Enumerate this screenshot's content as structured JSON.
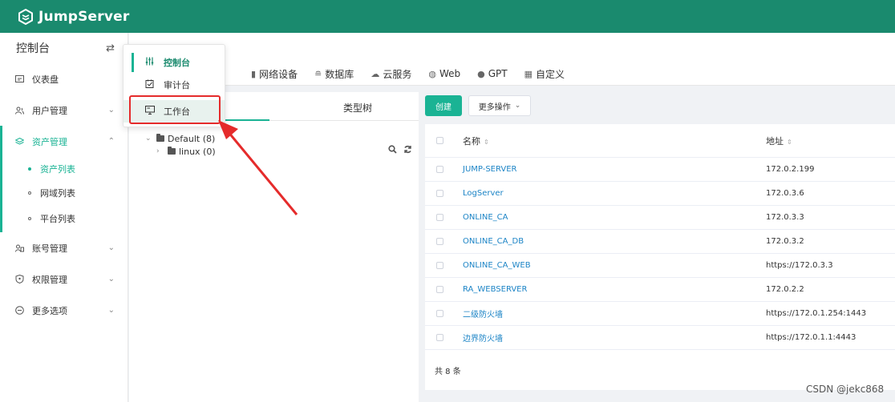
{
  "app": {
    "name": "JumpServer",
    "brand_color": "#1a8a6e",
    "accent_color": "#1ab394",
    "link_color": "#1c84c6"
  },
  "sidebar": {
    "title": "控制台",
    "items": [
      {
        "label": "仪表盘",
        "icon": "dashboard-icon"
      },
      {
        "label": "用户管理",
        "icon": "users-icon"
      },
      {
        "label": "资产管理",
        "icon": "assets-icon"
      },
      {
        "label": "账号管理",
        "icon": "accounts-icon"
      },
      {
        "label": "权限管理",
        "icon": "permission-icon"
      },
      {
        "label": "更多选项",
        "icon": "more-icon"
      }
    ],
    "asset_sub": [
      "资产列表",
      "网域列表",
      "平台列表"
    ]
  },
  "view_menu": {
    "items": [
      {
        "label": "控制台",
        "icon": "sliders-icon"
      },
      {
        "label": "审计台",
        "icon": "audit-icon"
      },
      {
        "label": "工作台",
        "icon": "monitor-icon"
      }
    ]
  },
  "tabs": [
    {
      "label": "网络设备",
      "icon": "network-device-icon"
    },
    {
      "label": "数据库",
      "icon": "database-icon"
    },
    {
      "label": "云服务",
      "icon": "cloud-icon"
    },
    {
      "label": "Web",
      "icon": "globe-icon"
    },
    {
      "label": "GPT",
      "icon": "chat-icon"
    },
    {
      "label": "自定义",
      "icon": "grid-icon"
    }
  ],
  "tree": {
    "tab_type": "类型树",
    "nodes": [
      {
        "label": "Default (8)"
      },
      {
        "label": "linux (0)"
      }
    ]
  },
  "toolbar": {
    "create": "创建",
    "more_actions": "更多操作"
  },
  "table": {
    "headers": {
      "name": "名称",
      "address": "地址"
    },
    "rows": [
      {
        "name": "JUMP-SERVER",
        "address": "172.0.2.199"
      },
      {
        "name": "LogServer",
        "address": "172.0.3.6"
      },
      {
        "name": "ONLINE_CA",
        "address": "172.0.3.3"
      },
      {
        "name": "ONLINE_CA_DB",
        "address": "172.0.3.2"
      },
      {
        "name": "ONLINE_CA_WEB",
        "address": "https://172.0.3.3"
      },
      {
        "name": "RA_WEBSERVER",
        "address": "172.0.2.2"
      },
      {
        "name": "二级防火墙",
        "address": "https://172.0.1.254:1443"
      },
      {
        "name": "边界防火墙",
        "address": "https://172.0.1.1:4443"
      }
    ],
    "total": "共 8 条"
  },
  "watermark": "CSDN @jekc868"
}
